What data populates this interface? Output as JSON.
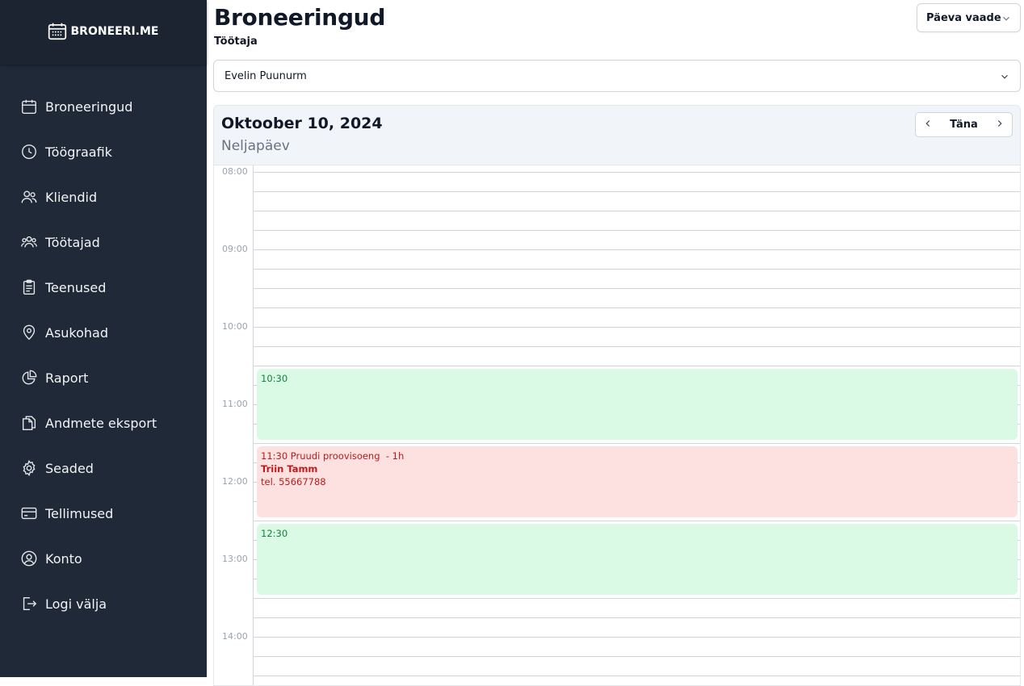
{
  "brand": {
    "name": "BRONEERI.ME"
  },
  "sidebar": {
    "items": [
      {
        "label": "Broneeringud",
        "icon": "calendar-icon"
      },
      {
        "label": "Töögraafik",
        "icon": "clock-icon"
      },
      {
        "label": "Kliendid",
        "icon": "users-icon"
      },
      {
        "label": "Töötajad",
        "icon": "user-group-icon"
      },
      {
        "label": "Teenused",
        "icon": "clipboard-icon"
      },
      {
        "label": "Asukohad",
        "icon": "map-pin-icon"
      },
      {
        "label": "Raport",
        "icon": "pie-chart-icon"
      },
      {
        "label": "Andmete eksport",
        "icon": "documents-icon"
      },
      {
        "label": "Seaded",
        "icon": "gear-icon"
      },
      {
        "label": "Tellimused",
        "icon": "credit-card-icon"
      },
      {
        "label": "Konto",
        "icon": "user-circle-icon"
      },
      {
        "label": "Logi välja",
        "icon": "logout-icon"
      }
    ]
  },
  "header": {
    "title": "Broneeringud",
    "subtitle": "Töötaja",
    "view_select": "Päeva vaade"
  },
  "employee_select": {
    "value": "Evelin Puunurm"
  },
  "calendar": {
    "date": "Oktoober 10, 2024",
    "weekday": "Neljapäev",
    "today_label": "Täna",
    "hours": [
      "08:00",
      "09:00",
      "10:00",
      "11:00",
      "12:00",
      "13:00",
      "14:00"
    ],
    "events": [
      {
        "type": "free",
        "time": "10:30"
      },
      {
        "type": "booked",
        "line1": "11:30 Pruudi proovisoeng  - 1h",
        "client": "Triin Tamm",
        "phone": "tel. 55667788"
      },
      {
        "type": "free",
        "time": "12:30"
      }
    ]
  },
  "colors": {
    "sidebar_bg": "#1f2937",
    "free_bg": "#dafae6",
    "booked_bg": "#fde0e0"
  }
}
